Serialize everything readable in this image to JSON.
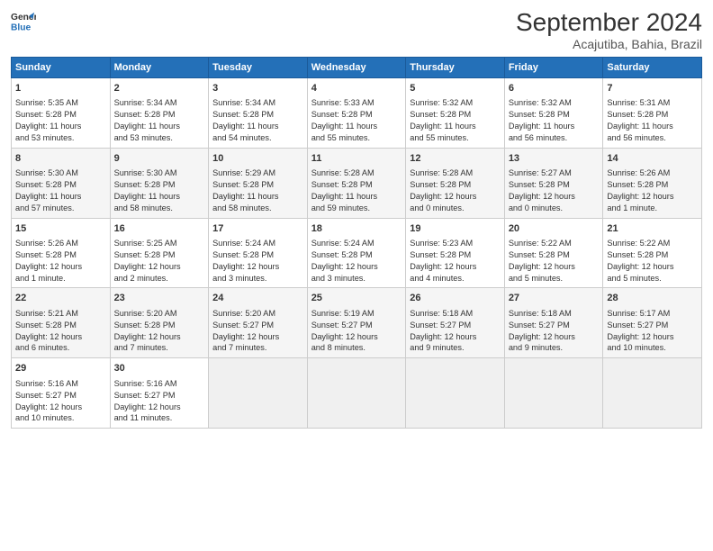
{
  "header": {
    "logo_line1": "General",
    "logo_line2": "Blue",
    "title": "September 2024",
    "subtitle": "Acajutiba, Bahia, Brazil"
  },
  "days_of_week": [
    "Sunday",
    "Monday",
    "Tuesday",
    "Wednesday",
    "Thursday",
    "Friday",
    "Saturday"
  ],
  "weeks": [
    [
      {
        "day": "1",
        "text": "Sunrise: 5:35 AM\nSunset: 5:28 PM\nDaylight: 11 hours\nand 53 minutes."
      },
      {
        "day": "2",
        "text": "Sunrise: 5:34 AM\nSunset: 5:28 PM\nDaylight: 11 hours\nand 53 minutes."
      },
      {
        "day": "3",
        "text": "Sunrise: 5:34 AM\nSunset: 5:28 PM\nDaylight: 11 hours\nand 54 minutes."
      },
      {
        "day": "4",
        "text": "Sunrise: 5:33 AM\nSunset: 5:28 PM\nDaylight: 11 hours\nand 55 minutes."
      },
      {
        "day": "5",
        "text": "Sunrise: 5:32 AM\nSunset: 5:28 PM\nDaylight: 11 hours\nand 55 minutes."
      },
      {
        "day": "6",
        "text": "Sunrise: 5:32 AM\nSunset: 5:28 PM\nDaylight: 11 hours\nand 56 minutes."
      },
      {
        "day": "7",
        "text": "Sunrise: 5:31 AM\nSunset: 5:28 PM\nDaylight: 11 hours\nand 56 minutes."
      }
    ],
    [
      {
        "day": "8",
        "text": "Sunrise: 5:30 AM\nSunset: 5:28 PM\nDaylight: 11 hours\nand 57 minutes."
      },
      {
        "day": "9",
        "text": "Sunrise: 5:30 AM\nSunset: 5:28 PM\nDaylight: 11 hours\nand 58 minutes."
      },
      {
        "day": "10",
        "text": "Sunrise: 5:29 AM\nSunset: 5:28 PM\nDaylight: 11 hours\nand 58 minutes."
      },
      {
        "day": "11",
        "text": "Sunrise: 5:28 AM\nSunset: 5:28 PM\nDaylight: 11 hours\nand 59 minutes."
      },
      {
        "day": "12",
        "text": "Sunrise: 5:28 AM\nSunset: 5:28 PM\nDaylight: 12 hours\nand 0 minutes."
      },
      {
        "day": "13",
        "text": "Sunrise: 5:27 AM\nSunset: 5:28 PM\nDaylight: 12 hours\nand 0 minutes."
      },
      {
        "day": "14",
        "text": "Sunrise: 5:26 AM\nSunset: 5:28 PM\nDaylight: 12 hours\nand 1 minute."
      }
    ],
    [
      {
        "day": "15",
        "text": "Sunrise: 5:26 AM\nSunset: 5:28 PM\nDaylight: 12 hours\nand 1 minute."
      },
      {
        "day": "16",
        "text": "Sunrise: 5:25 AM\nSunset: 5:28 PM\nDaylight: 12 hours\nand 2 minutes."
      },
      {
        "day": "17",
        "text": "Sunrise: 5:24 AM\nSunset: 5:28 PM\nDaylight: 12 hours\nand 3 minutes."
      },
      {
        "day": "18",
        "text": "Sunrise: 5:24 AM\nSunset: 5:28 PM\nDaylight: 12 hours\nand 3 minutes."
      },
      {
        "day": "19",
        "text": "Sunrise: 5:23 AM\nSunset: 5:28 PM\nDaylight: 12 hours\nand 4 minutes."
      },
      {
        "day": "20",
        "text": "Sunrise: 5:22 AM\nSunset: 5:28 PM\nDaylight: 12 hours\nand 5 minutes."
      },
      {
        "day": "21",
        "text": "Sunrise: 5:22 AM\nSunset: 5:28 PM\nDaylight: 12 hours\nand 5 minutes."
      }
    ],
    [
      {
        "day": "22",
        "text": "Sunrise: 5:21 AM\nSunset: 5:28 PM\nDaylight: 12 hours\nand 6 minutes."
      },
      {
        "day": "23",
        "text": "Sunrise: 5:20 AM\nSunset: 5:28 PM\nDaylight: 12 hours\nand 7 minutes."
      },
      {
        "day": "24",
        "text": "Sunrise: 5:20 AM\nSunset: 5:27 PM\nDaylight: 12 hours\nand 7 minutes."
      },
      {
        "day": "25",
        "text": "Sunrise: 5:19 AM\nSunset: 5:27 PM\nDaylight: 12 hours\nand 8 minutes."
      },
      {
        "day": "26",
        "text": "Sunrise: 5:18 AM\nSunset: 5:27 PM\nDaylight: 12 hours\nand 9 minutes."
      },
      {
        "day": "27",
        "text": "Sunrise: 5:18 AM\nSunset: 5:27 PM\nDaylight: 12 hours\nand 9 minutes."
      },
      {
        "day": "28",
        "text": "Sunrise: 5:17 AM\nSunset: 5:27 PM\nDaylight: 12 hours\nand 10 minutes."
      }
    ],
    [
      {
        "day": "29",
        "text": "Sunrise: 5:16 AM\nSunset: 5:27 PM\nDaylight: 12 hours\nand 10 minutes."
      },
      {
        "day": "30",
        "text": "Sunrise: 5:16 AM\nSunset: 5:27 PM\nDaylight: 12 hours\nand 11 minutes."
      },
      {
        "day": "",
        "text": ""
      },
      {
        "day": "",
        "text": ""
      },
      {
        "day": "",
        "text": ""
      },
      {
        "day": "",
        "text": ""
      },
      {
        "day": "",
        "text": ""
      }
    ]
  ]
}
